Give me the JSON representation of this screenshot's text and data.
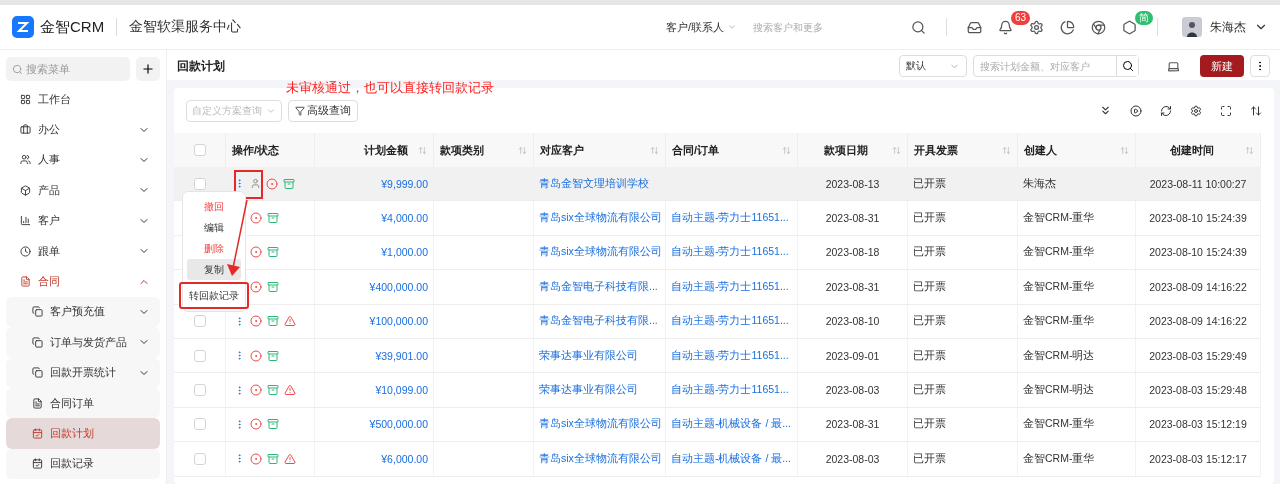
{
  "header": {
    "brand": "金智CRM",
    "subtitle": "金智软渠服务中心",
    "search_scope": "客户/联系人",
    "search_placeholder": "搜索客户和更多",
    "notifications_badge": "63",
    "app_badge": "简",
    "user": "朱海杰"
  },
  "sidebar": {
    "search_placeholder": "搜索菜单",
    "items": [
      {
        "label": "工作台",
        "expandable": false,
        "expanded": false,
        "selected": false
      },
      {
        "label": "办公",
        "expandable": true,
        "expanded": false,
        "selected": false
      },
      {
        "label": "人事",
        "expandable": true,
        "expanded": false,
        "selected": false
      },
      {
        "label": "产品",
        "expandable": true,
        "expanded": false,
        "selected": false
      },
      {
        "label": "客户",
        "expandable": true,
        "expanded": false,
        "selected": false
      },
      {
        "label": "跟单",
        "expandable": true,
        "expanded": false,
        "selected": false
      },
      {
        "label": "合同",
        "expandable": true,
        "expanded": true,
        "selected": false,
        "children": [
          {
            "label": "客户预充值",
            "expandable": true,
            "selected": false
          },
          {
            "label": "订单与发货产品",
            "expandable": true,
            "selected": false
          },
          {
            "label": "回款开票统计",
            "expandable": true,
            "selected": false
          },
          {
            "label": "合同订单",
            "expandable": false,
            "selected": false
          },
          {
            "label": "回款计划",
            "expandable": false,
            "selected": true
          },
          {
            "label": "回款记录",
            "expandable": false,
            "selected": false
          }
        ]
      }
    ]
  },
  "page": {
    "title": "回款计划",
    "view_select": "默认",
    "search_placeholder": "搜索计划金额、对应客户",
    "new_button": "新建",
    "scheme_placeholder": "自定义方案查询",
    "advanced_button": "高级查询"
  },
  "annotation": "未审核通过，也可以直接转回款记录",
  "table": {
    "all_checked": false,
    "columns": [
      {
        "sortable": false
      },
      {
        "label": "操作/状态",
        "sortable": false
      },
      {
        "label": "计划金额",
        "sortable": true
      },
      {
        "label": "款项类别",
        "sortable": true
      },
      {
        "label": "对应客户",
        "sortable": true
      },
      {
        "label": "合同/订单",
        "sortable": true
      },
      {
        "label": "款项日期",
        "sortable": true
      },
      {
        "label": "开具发票",
        "sortable": true
      },
      {
        "label": "创建人",
        "sortable": true
      },
      {
        "label": "创建时间",
        "sortable": true
      }
    ],
    "rows": [
      {
        "checked": false,
        "highlighted": true,
        "approver": true,
        "warning": false,
        "amount": "¥9,999.00",
        "customer": "青岛金智文理培训学校",
        "date": "2023-08-13",
        "invoice": "已开票",
        "creator": "朱海杰",
        "created": "2023-08-11 10:00:27"
      },
      {
        "highlighted": false,
        "approver": false,
        "warning": false,
        "amount": "¥4,000.00",
        "customer": "青岛six全球物流有限公司",
        "contract": "自动主题-劳力士11651...",
        "date": "2023-08-31",
        "invoice": "已开票",
        "creator": "金智CRM-重华",
        "created": "2023-08-10 15:24:39"
      },
      {
        "highlighted": false,
        "approver": false,
        "warning": false,
        "amount": "¥1,000.00",
        "customer": "青岛six全球物流有限公司",
        "contract": "自动主题-劳力士11651...",
        "date": "2023-08-18",
        "invoice": "已开票",
        "creator": "金智CRM-重华",
        "created": "2023-08-10 15:24:39"
      },
      {
        "highlighted": false,
        "approver": false,
        "warning": false,
        "amount": "¥400,000.00",
        "customer": "青岛金智电子科技有限...",
        "contract": "自动主题-劳力士11651...",
        "date": "2023-08-31",
        "invoice": "已开票",
        "creator": "金智CRM-重华",
        "created": "2023-08-09 14:16:22"
      },
      {
        "checked": false,
        "highlighted": false,
        "approver": false,
        "warning": true,
        "amount": "¥100,000.00",
        "customer": "青岛金智电子科技有限...",
        "contract": "自动主题-劳力士11651...",
        "date": "2023-08-10",
        "invoice": "已开票",
        "creator": "金智CRM-重华",
        "created": "2023-08-09 14:16:22"
      },
      {
        "checked": false,
        "highlighted": false,
        "approver": false,
        "warning": false,
        "amount": "¥39,901.00",
        "customer": "荣事达事业有限公司",
        "contract": "自动主题-劳力士11651...",
        "date": "2023-09-01",
        "invoice": "已开票",
        "creator": "金智CRM-明达",
        "created": "2023-08-03 15:29:49"
      },
      {
        "checked": false,
        "highlighted": false,
        "approver": false,
        "warning": true,
        "amount": "¥10,099.00",
        "customer": "荣事达事业有限公司",
        "contract": "自动主题-劳力士11651...",
        "date": "2023-08-03",
        "invoice": "已开票",
        "creator": "金智CRM-明达",
        "created": "2023-08-03 15:29:48"
      },
      {
        "checked": false,
        "highlighted": false,
        "approver": false,
        "warning": false,
        "amount": "¥500,000.00",
        "customer": "青岛six全球物流有限公司",
        "contract": "自动主题-机械设备 / 最...",
        "date": "2023-08-31",
        "invoice": "已开票",
        "creator": "金智CRM-重华",
        "created": "2023-08-03 15:12:19"
      },
      {
        "checked": false,
        "highlighted": false,
        "approver": false,
        "warning": true,
        "amount": "¥6,000.00",
        "customer": "青岛six全球物流有限公司",
        "contract": "自动主题-机械设备 / 最...",
        "date": "2023-08-03",
        "invoice": "已开票",
        "creator": "金智CRM-重华",
        "created": "2023-08-03 15:12:17"
      }
    ]
  },
  "row_menu": {
    "items": [
      {
        "label": "撤回",
        "danger": true,
        "hovered": false,
        "outlined": false
      },
      {
        "label": "编辑",
        "danger": false,
        "hovered": false,
        "outlined": false
      },
      {
        "label": "删除",
        "danger": true,
        "hovered": false,
        "outlined": false
      },
      {
        "label": "复制",
        "danger": false,
        "hovered": true,
        "outlined": false
      },
      {
        "label": "转回款记录",
        "danger": false,
        "hovered": false,
        "outlined": true
      }
    ]
  }
}
